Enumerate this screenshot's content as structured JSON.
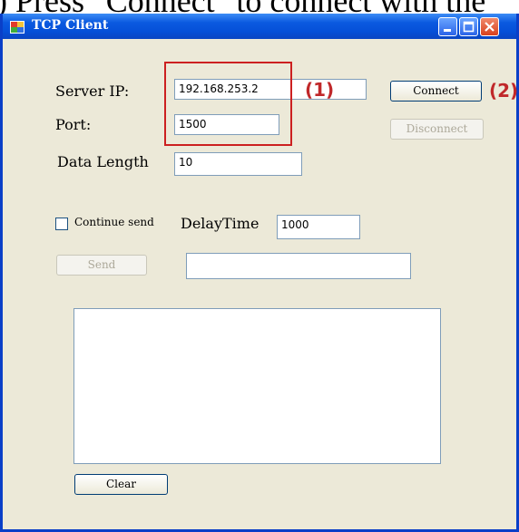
{
  "caption": ") Press \"Connect\" to connect with the",
  "window": {
    "title": "TCP Client"
  },
  "form": {
    "server_ip_label": "Server IP:",
    "server_ip_value": "192.168.253.2",
    "port_label": "Port:",
    "port_value": "1500",
    "data_length_label": "Data Length",
    "data_length_value": "10",
    "continue_send_label": "Continue send",
    "continue_send_checked": false,
    "delay_time_label": "DelayTime",
    "delay_time_value": "1000",
    "send_text_value": ""
  },
  "buttons": {
    "connect": "Connect",
    "disconnect": "Disconnect",
    "send": "Send",
    "clear": "Clear"
  },
  "annotations": {
    "step1": "(1)",
    "step2": "(2)"
  },
  "colors": {
    "annotation_red": "#c0282a",
    "titlebar_blue": "#0550d8",
    "window_bg": "#ece9d8"
  }
}
